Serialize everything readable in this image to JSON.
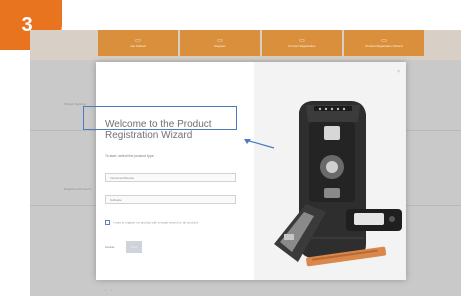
{
  "step": "3",
  "toolbar": {
    "tiles": [
      "Get Started",
      "Register",
      "Product Registration",
      "Product Registration Wizard"
    ]
  },
  "background": {
    "rows": [
      "Product Settings",
      "Registered Products"
    ]
  },
  "dialog": {
    "close": "×",
    "title": "Welcome to the Product Registration Wizard",
    "subtitle": "To start, select the product type",
    "options": [
      "Instrument/Device",
      "Software"
    ],
    "checkbox_label": "I want to register my product with a single wizard for all products",
    "cancel": "Cancel",
    "next": "Next",
    "pager": "• •"
  },
  "colors": {
    "accent": "#e8741f",
    "highlight": "#4a7cc3"
  }
}
